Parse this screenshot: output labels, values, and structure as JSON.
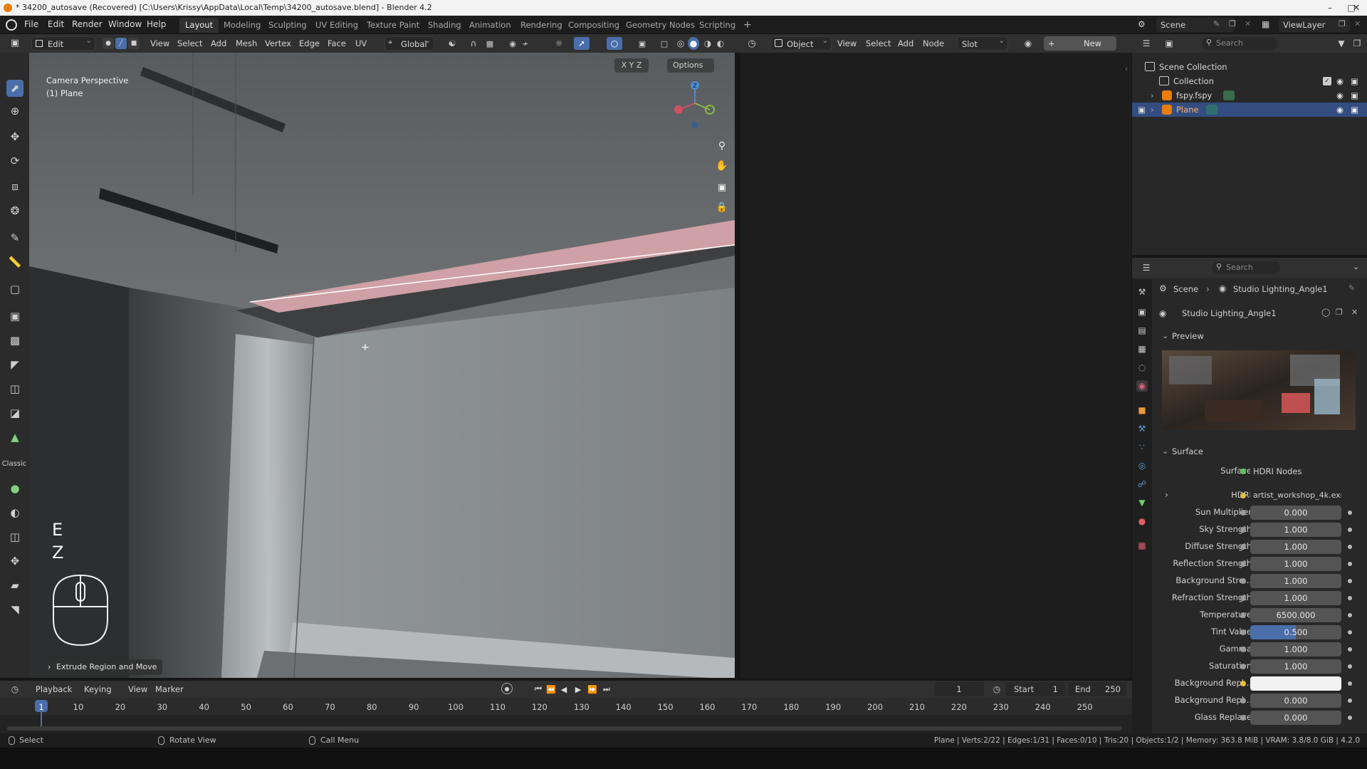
{
  "window": {
    "title": "* 34200_autosave (Recovered) [C:\\Users\\Krissy\\AppData\\Local\\Temp\\34200_autosave.blend] - Blender 4.2"
  },
  "menubar": {
    "items": [
      "File",
      "Edit",
      "Render",
      "Window",
      "Help"
    ]
  },
  "workspaces": {
    "tabs": [
      "Layout",
      "Modeling",
      "Sculpting",
      "UV Editing",
      "Texture Paint",
      "Shading",
      "Animation",
      "Rendering",
      "Compositing",
      "Geometry Nodes",
      "Scripting"
    ],
    "active": "Layout",
    "add": "+"
  },
  "scene": {
    "label": "Scene",
    "view_layer": "ViewLayer"
  },
  "view3d": {
    "mode": "Edit Mode",
    "menus": [
      "View",
      "Select",
      "Add",
      "Mesh",
      "Vertex",
      "Edge",
      "Face",
      "UV"
    ],
    "orientation": "Global",
    "axes": [
      "X",
      "Y",
      "Z"
    ],
    "options": "Options",
    "overlay_title": "Camera Perspective",
    "overlay_object": "(1) Plane",
    "key_e": "E",
    "key_z": "Z",
    "last_op": "Extrude Region and Move",
    "gizmo_z": "Z"
  },
  "node_header": {
    "object": "Object",
    "menus": [
      "View",
      "Select",
      "Add",
      "Node"
    ],
    "slot": "Slot",
    "new": "New"
  },
  "outliner": {
    "search_placeholder": "Search",
    "scene_collection": "Scene Collection",
    "collection": "Collection",
    "items": [
      "fspy.fspy",
      "Plane"
    ]
  },
  "properties": {
    "search_placeholder": "Search",
    "breadcrumb": [
      "Scene",
      "Studio Lighting_Angle1"
    ],
    "world_name": "Studio Lighting_Angle1",
    "preview_label": "Preview",
    "surface_label": "Surface",
    "surface_row": {
      "label": "Surface",
      "value": "HDRI Nodes"
    },
    "hdri_row": {
      "label": "HDRI",
      "value": "artist_workshop_4k.exr...."
    },
    "rows": [
      {
        "label": "Sun Multiplier",
        "value": "0.000"
      },
      {
        "label": "Sky Strength",
        "value": "1.000"
      },
      {
        "label": "Diffuse Strength",
        "value": "1.000"
      },
      {
        "label": "Reflection Strength",
        "value": "1.000"
      },
      {
        "label": "Background Stre...",
        "value": "1.000"
      },
      {
        "label": "Refraction Strength",
        "value": "1.000"
      },
      {
        "label": "Temperature",
        "value": "6500.000"
      },
      {
        "label": "Tint Value",
        "value": "0.500",
        "fill": 0.5
      },
      {
        "label": "Gamma",
        "value": "1.000"
      },
      {
        "label": "Saturation",
        "value": "1.000"
      },
      {
        "label": "Background Repl...",
        "value": ""
      },
      {
        "label": "Background Repl...",
        "value": "0.000"
      },
      {
        "label": "Glass Replace",
        "value": "0.000"
      }
    ]
  },
  "timeline": {
    "menus": [
      "Playback",
      "Keying",
      "View",
      "Marker"
    ],
    "current_frame": "1",
    "start_label": "Start",
    "start": "1",
    "end_label": "End",
    "end": "250",
    "ticks": [
      "1",
      "10",
      "20",
      "30",
      "40",
      "50",
      "60",
      "70",
      "80",
      "90",
      "100",
      "110",
      "120",
      "130",
      "140",
      "150",
      "160",
      "170",
      "180",
      "190",
      "200",
      "210",
      "220",
      "230",
      "240",
      "250"
    ]
  },
  "statusbar": {
    "select": "Select",
    "rotate": "Rotate View",
    "call_menu": "Call Menu",
    "stats": "Plane | Verts:2/22 | Edges:1/31 | Faces:0/10 | Tris:20 | Objects:1/2 | Memory: 363.8 MiB | VRAM: 3.8/8.0 GiB | 4.2.0"
  },
  "colors": {
    "accent": "#4a6ea9",
    "selected_row": "#334d80",
    "orange": "#e87d0d",
    "edit_pink": "#cfa0a5"
  }
}
